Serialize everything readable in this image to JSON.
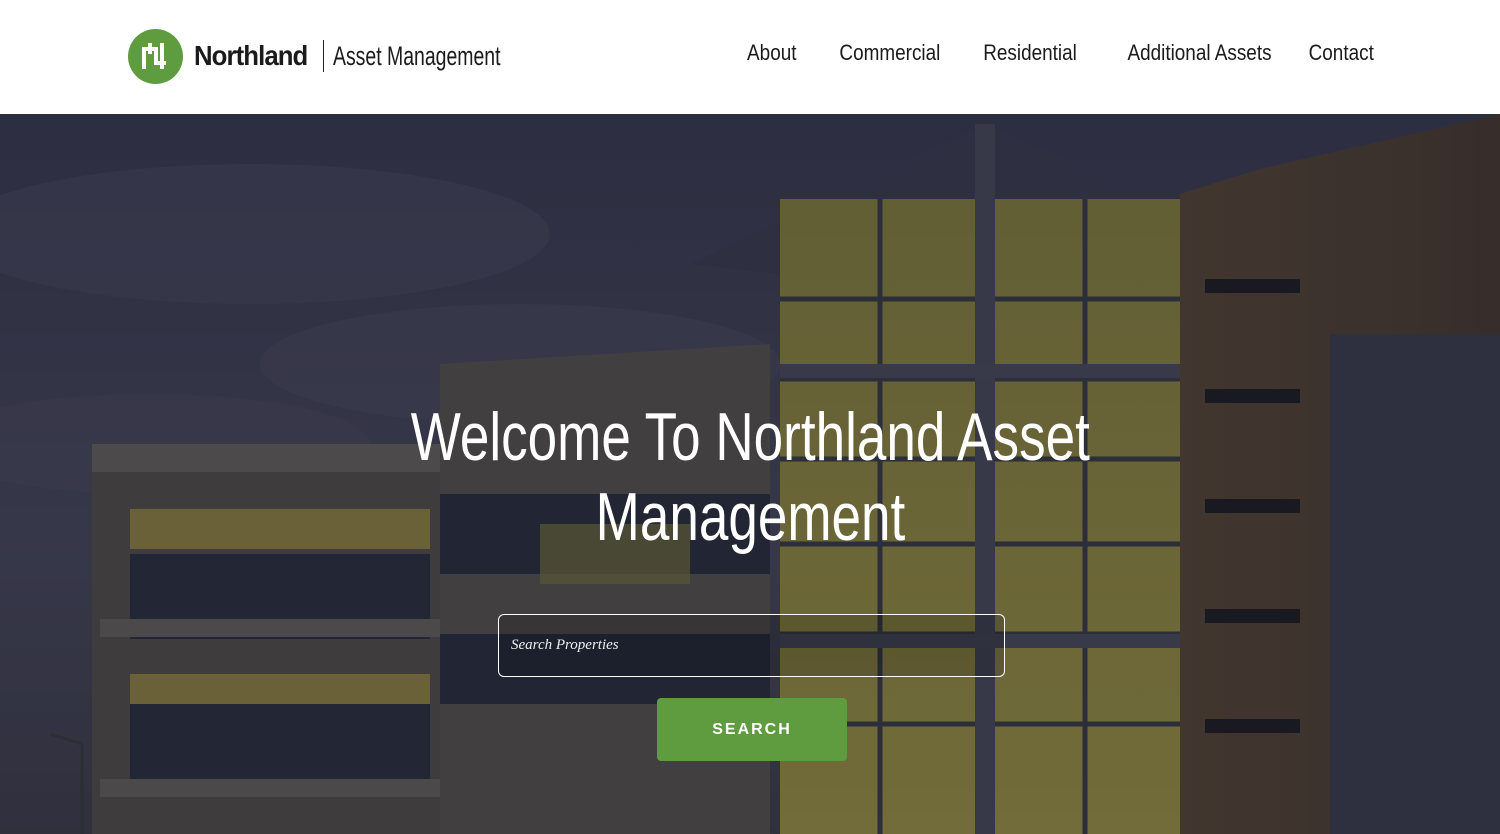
{
  "brand": {
    "name": "Northland",
    "sub": "Asset Management",
    "accent_color": "#5f9c3f",
    "logo_icon": "northland-logo-mark-icon"
  },
  "nav": {
    "items": [
      {
        "label": "About"
      },
      {
        "label": "Commercial"
      },
      {
        "label": "Residential"
      },
      {
        "label": "Additional Assets"
      },
      {
        "label": "Contact"
      }
    ]
  },
  "hero": {
    "title_line1": "Welcome To Northland Asset",
    "title_line2": "Management",
    "search": {
      "placeholder": "Search Properties",
      "value": ""
    },
    "search_button_label": "SEARCH"
  }
}
